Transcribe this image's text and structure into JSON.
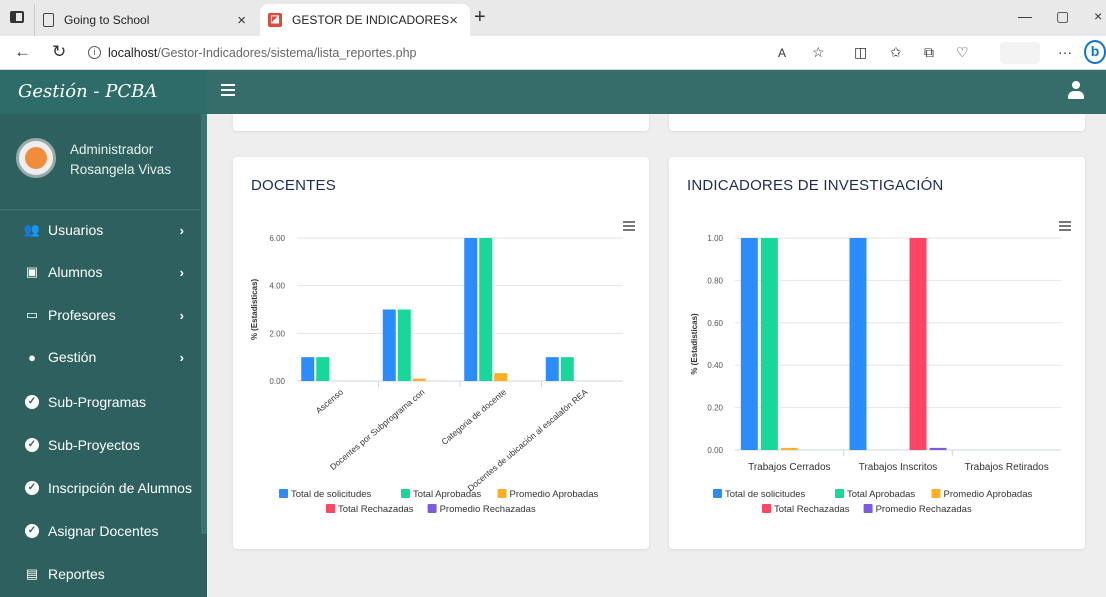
{
  "browser": {
    "tabs": [
      {
        "title": "Going to School",
        "close": "×"
      },
      {
        "title": "GESTOR DE INDICADORES",
        "close": "×"
      }
    ],
    "new_tab": "+",
    "url_host": "localhost",
    "url_path": "/Gestor-Indicadores/sistema/lista_reportes.php",
    "window_controls": {
      "minimize": "—",
      "restore": "▢",
      "close": "×"
    },
    "more": "···"
  },
  "app": {
    "brand": "Gestión - PCBA",
    "user": {
      "role": "Administrador",
      "name": "Rosangela Vivas"
    },
    "menu": [
      {
        "label": "Usuarios",
        "icon": "users-icon",
        "chevron": true
      },
      {
        "label": "Alumnos",
        "icon": "student-icon",
        "chevron": true
      },
      {
        "label": "Profesores",
        "icon": "presentation-icon",
        "chevron": true
      },
      {
        "label": "Gestión",
        "icon": "user-icon",
        "chevron": true
      },
      {
        "label": "Sub-Programas",
        "icon": "check-circle-icon",
        "chevron": false
      },
      {
        "label": "Sub-Proyectos",
        "icon": "check-circle-icon",
        "chevron": false
      },
      {
        "label": "Inscripción de Alumnos",
        "icon": "check-circle-icon",
        "chevron": false
      },
      {
        "label": "Asignar Docentes",
        "icon": "check-circle-icon",
        "chevron": false
      },
      {
        "label": "Reportes",
        "icon": "pdf-icon",
        "chevron": false
      }
    ]
  },
  "chart_data": [
    {
      "type": "bar",
      "title": "DOCENTES",
      "ylabel": "% (Estadisticas)",
      "ylim": [
        0,
        6
      ],
      "yticks": [
        "0.00",
        "2.00",
        "4.00",
        "6.00"
      ],
      "categories": [
        "Ascenso",
        "Docentes por Subprograma con",
        "Categoria de docente",
        "Docentes de ubicación al escalafón REA"
      ],
      "series": [
        {
          "name": "Total de solicitudes",
          "color": "#2b8cff",
          "values": [
            1,
            3,
            6,
            1
          ]
        },
        {
          "name": "Total Aprobadas",
          "color": "#17d89a",
          "values": [
            1,
            3,
            6,
            1
          ]
        },
        {
          "name": "Promedio Aprobadas",
          "color": "#ffb020",
          "values": [
            0,
            0.1,
            0.33,
            0
          ]
        },
        {
          "name": "Total Rechazadas",
          "color": "#ff4564",
          "values": [
            0,
            0,
            0,
            0
          ]
        },
        {
          "name": "Promedio Rechazadas",
          "color": "#7b5ce0",
          "values": [
            0,
            0,
            0,
            0
          ]
        }
      ],
      "legend": "bottom"
    },
    {
      "type": "bar",
      "title": "INDICADORES DE INVESTIGACIÓN",
      "ylabel": "% (Estadisticas)",
      "ylim": [
        0,
        1
      ],
      "yticks": [
        "0.00",
        "0.20",
        "0.40",
        "0.60",
        "0.80",
        "1.00"
      ],
      "categories": [
        "Trabajos Cerrados",
        "Trabajos Inscritos",
        "Trabajos Retirados"
      ],
      "series": [
        {
          "name": "Total de solicitudes",
          "color": "#2b8cff",
          "values": [
            1,
            1,
            0
          ]
        },
        {
          "name": "Total Aprobadas",
          "color": "#17d89a",
          "values": [
            1,
            0,
            0
          ]
        },
        {
          "name": "Promedio Aprobadas",
          "color": "#ffb020",
          "values": [
            0.01,
            0,
            0
          ]
        },
        {
          "name": "Total Rechazadas",
          "color": "#ff4564",
          "values": [
            0,
            1,
            0
          ]
        },
        {
          "name": "Promedio Rechazadas",
          "color": "#7b5ce0",
          "values": [
            0,
            0.01,
            0
          ]
        }
      ],
      "legend": "bottom"
    }
  ]
}
